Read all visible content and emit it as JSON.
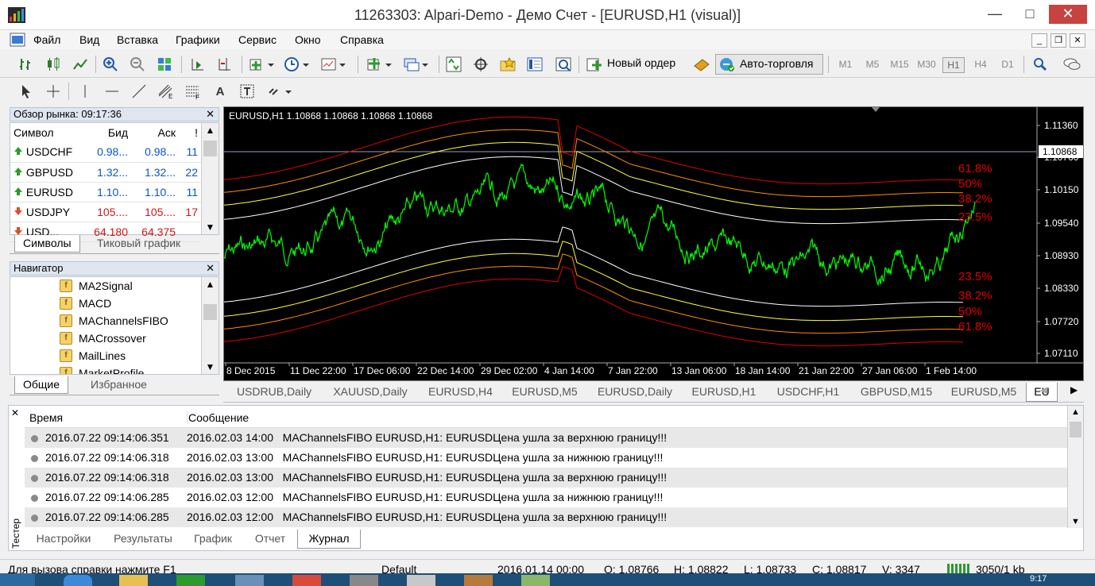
{
  "window": {
    "title": "11263303: Alpari-Demo - Демо Счет - [EURUSD,H1 (visual)]"
  },
  "menu": [
    "Файл",
    "Вид",
    "Вставка",
    "Графики",
    "Сервис",
    "Окно",
    "Справка"
  ],
  "toolbar": {
    "new_order": "Новый ордер",
    "autotrading": "Авто-торговля",
    "timeframes": [
      "M1",
      "M5",
      "M15",
      "M30",
      "H1",
      "H4",
      "D1"
    ],
    "active_tf": "H1"
  },
  "market_watch": {
    "title": "Обзор рынка: 09:17:36",
    "headers": [
      "Символ",
      "Бид",
      "Аск",
      "!"
    ],
    "rows": [
      {
        "symbol": "USDCHF",
        "bid": "0.98...",
        "ask": "0.98...",
        "spread": "11",
        "dir": "up"
      },
      {
        "symbol": "GBPUSD",
        "bid": "1.32...",
        "ask": "1.32...",
        "spread": "22",
        "dir": "up"
      },
      {
        "symbol": "EURUSD",
        "bid": "1.10...",
        "ask": "1.10...",
        "spread": "11",
        "dir": "up"
      },
      {
        "symbol": "USDJPY",
        "bid": "105....",
        "ask": "105....",
        "spread": "17",
        "dir": "down"
      },
      {
        "symbol": "USD...",
        "bid": "64.180",
        "ask": "64.375",
        "spread": "",
        "dir": "down"
      }
    ],
    "tabs": [
      "Символы",
      "Тиковый график"
    ]
  },
  "navigator": {
    "title": "Навигатор",
    "items": [
      "MA2Signal",
      "MACD",
      "MAChannelsFIBO",
      "MACrossover",
      "MailLines",
      "MarketProfile"
    ],
    "tabs": [
      "Общие",
      "Избранное"
    ]
  },
  "chart": {
    "header": "EURUSD,H1  1.10868 1.10868 1.10868 1.10868",
    "price_labels": [
      "1.11360",
      "1.10760",
      "1.10150",
      "1.09540",
      "1.08930",
      "1.08330",
      "1.07720",
      "1.07110"
    ],
    "current_price": "1.10868",
    "time_labels": [
      "8 Dec 2015",
      "11 Dec 22:00",
      "17 Dec 06:00",
      "22 Dec 14:00",
      "29 Dec 02:00",
      "4 Jan 14:00",
      "7 Jan 22:00",
      "13 Jan 06:00",
      "18 Jan 14:00",
      "21 Jan 22:00",
      "27 Jan 06:00",
      "1 Feb 14:00"
    ],
    "fibo_upper": [
      "61.8%",
      "50%",
      "38.2%",
      "23.5%"
    ],
    "fibo_lower": [
      "23.5%",
      "38.2%",
      "50%",
      "61.8%"
    ],
    "colors": {
      "price": "#00ff00",
      "red": "#e00000",
      "orange": "#ff8c00",
      "yellow": "#ffff40",
      "white": "#ffffff"
    }
  },
  "chart_tabs": [
    "USDRUB,Daily",
    "XAUUSD,Daily",
    "EURUSD,H4",
    "EURUSD,M5",
    "EURUSD,Daily",
    "EURUSD,H1",
    "USDCHF,H1",
    "GBPUSD,M15",
    "EURUSD,M5",
    "EU"
  ],
  "log": {
    "headers": [
      "Время",
      "Сообщение"
    ],
    "rows": [
      {
        "time": "2016.07.22 09:14:06.351",
        "msg": "2016.02.03 14:00   MAChannelsFIBO EURUSD,H1: EURUSDЦена ушла за верхнюю границу!!!"
      },
      {
        "time": "2016.07.22 09:14:06.318",
        "msg": "2016.02.03 13:00   MAChannelsFIBO EURUSD,H1: EURUSDЦена ушла за нижнюю границу!!!"
      },
      {
        "time": "2016.07.22 09:14:06.318",
        "msg": "2016.02.03 13:00   MAChannelsFIBO EURUSD,H1: EURUSDЦена ушла за верхнюю границу!!!"
      },
      {
        "time": "2016.07.22 09:14:06.285",
        "msg": "2016.02.03 12:00   MAChannelsFIBO EURUSD,H1: EURUSDЦена ушла за нижнюю границу!!!"
      },
      {
        "time": "2016.07.22 09:14:06.285",
        "msg": "2016.02.03 12:00   MAChannelsFIBO EURUSD,H1: EURUSDЦена ушла за верхнюю границу!!!"
      }
    ],
    "side_label": "Тестер",
    "tabs": [
      "Настройки",
      "Результаты",
      "График",
      "Отчет",
      "Журнал"
    ],
    "active_tab": "Журнал"
  },
  "status": {
    "help": "Для вызова справки нажмите F1",
    "profile": "Default",
    "datetime": "2016.01.14 00:00",
    "open": "O: 1.08766",
    "high": "H: 1.08822",
    "low": "L: 1.08733",
    "close": "C: 1.08817",
    "volume": "V: 3347",
    "traffic": "3050/1 kb",
    "clock": "9:17"
  }
}
